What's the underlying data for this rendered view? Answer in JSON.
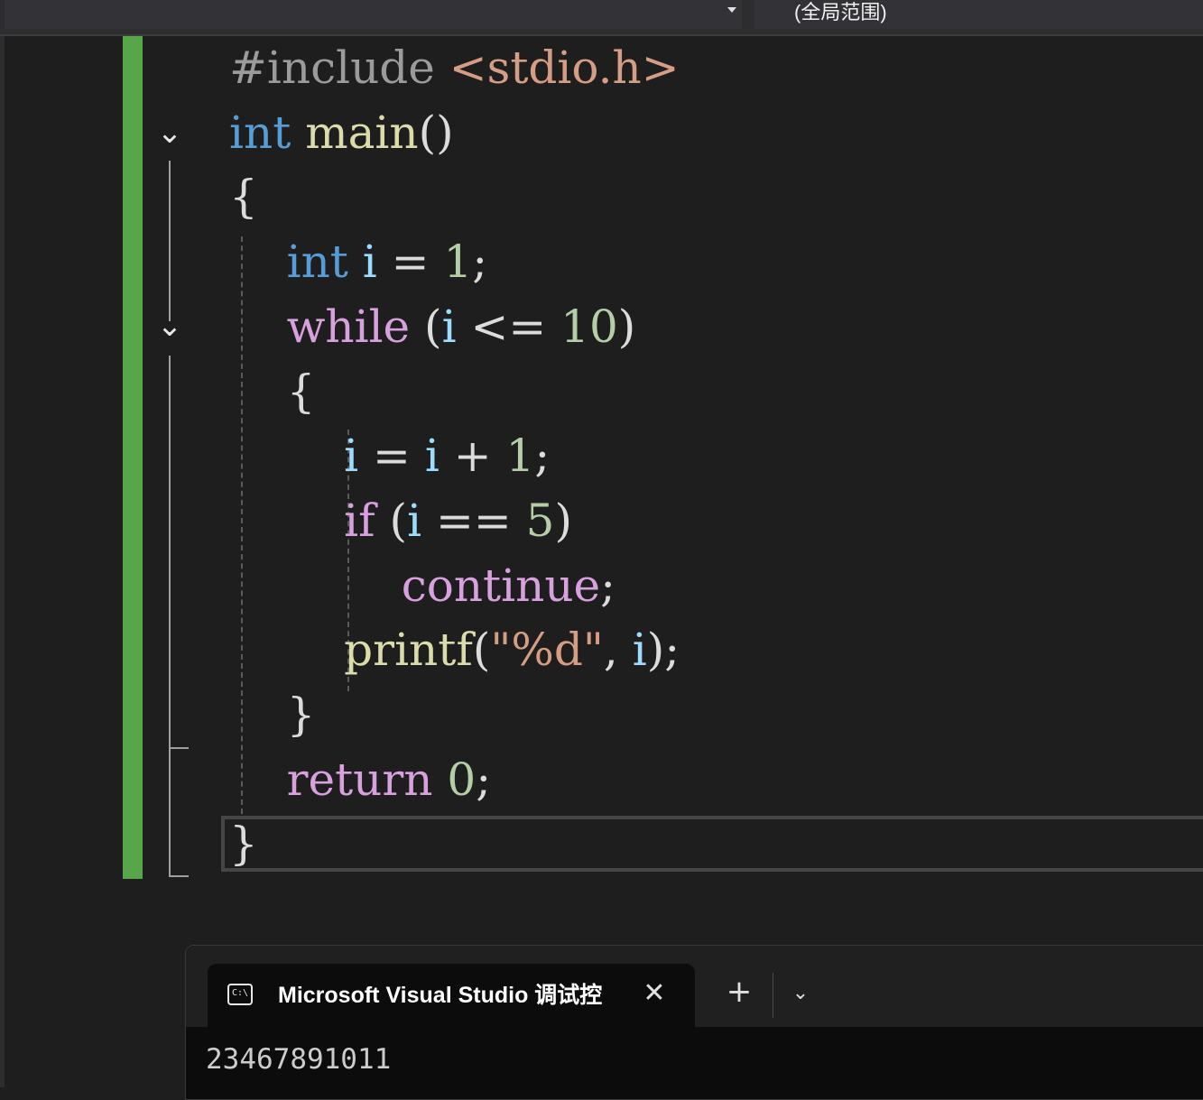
{
  "scope_bar": {
    "scope_label": "(全局范围)"
  },
  "editor": {
    "lines": [
      [
        {
          "t": "#include ",
          "c": "pre"
        },
        {
          "t": "<stdio.h>",
          "c": "inc"
        }
      ],
      [
        {
          "t": "int",
          "c": "kw"
        },
        {
          "t": " ",
          "c": "pun"
        },
        {
          "t": "main",
          "c": "fn"
        },
        {
          "t": "()",
          "c": "pun"
        }
      ],
      [
        {
          "t": "{",
          "c": "pun"
        }
      ],
      [
        {
          "t": "    ",
          "c": "pun"
        },
        {
          "t": "int",
          "c": "kw"
        },
        {
          "t": " ",
          "c": "pun"
        },
        {
          "t": "i",
          "c": "var"
        },
        {
          "t": " = ",
          "c": "pun"
        },
        {
          "t": "1",
          "c": "num"
        },
        {
          "t": ";",
          "c": "pun"
        }
      ],
      [
        {
          "t": "    ",
          "c": "pun"
        },
        {
          "t": "while",
          "c": "ctrl"
        },
        {
          "t": " (",
          "c": "pun"
        },
        {
          "t": "i",
          "c": "var"
        },
        {
          "t": " <= ",
          "c": "pun"
        },
        {
          "t": "10",
          "c": "num"
        },
        {
          "t": ")",
          "c": "pun"
        }
      ],
      [
        {
          "t": "    {",
          "c": "pun"
        }
      ],
      [
        {
          "t": "        ",
          "c": "pun"
        },
        {
          "t": "i",
          "c": "var"
        },
        {
          "t": " = ",
          "c": "pun"
        },
        {
          "t": "i",
          "c": "var"
        },
        {
          "t": " + ",
          "c": "pun"
        },
        {
          "t": "1",
          "c": "num"
        },
        {
          "t": ";",
          "c": "pun"
        }
      ],
      [
        {
          "t": "        ",
          "c": "pun"
        },
        {
          "t": "if",
          "c": "ctrl"
        },
        {
          "t": " (",
          "c": "pun"
        },
        {
          "t": "i",
          "c": "var"
        },
        {
          "t": " == ",
          "c": "pun"
        },
        {
          "t": "5",
          "c": "num"
        },
        {
          "t": ")",
          "c": "pun"
        }
      ],
      [
        {
          "t": "            ",
          "c": "pun"
        },
        {
          "t": "continue",
          "c": "ctrl"
        },
        {
          "t": ";",
          "c": "pun"
        }
      ],
      [
        {
          "t": "        ",
          "c": "pun"
        },
        {
          "t": "printf",
          "c": "fn"
        },
        {
          "t": "(",
          "c": "pun"
        },
        {
          "t": "\"%d\"",
          "c": "str"
        },
        {
          "t": ", ",
          "c": "pun"
        },
        {
          "t": "i",
          "c": "var"
        },
        {
          "t": ");",
          "c": "pun"
        }
      ],
      [
        {
          "t": "    }",
          "c": "pun"
        }
      ],
      [
        {
          "t": "    ",
          "c": "pun"
        },
        {
          "t": "return",
          "c": "ctrl"
        },
        {
          "t": " ",
          "c": "pun"
        },
        {
          "t": "0",
          "c": "num"
        },
        {
          "t": ";",
          "c": "pun"
        }
      ],
      [
        {
          "t": "}",
          "c": "pun"
        }
      ]
    ]
  },
  "terminal": {
    "tab_icon_text": "C:\\",
    "tab_title": "Microsoft Visual Studio 调试控",
    "close_glyph": "✕",
    "new_tab_glyph": "+",
    "dropdown_glyph": "⌄",
    "output_line": "23467891011"
  }
}
